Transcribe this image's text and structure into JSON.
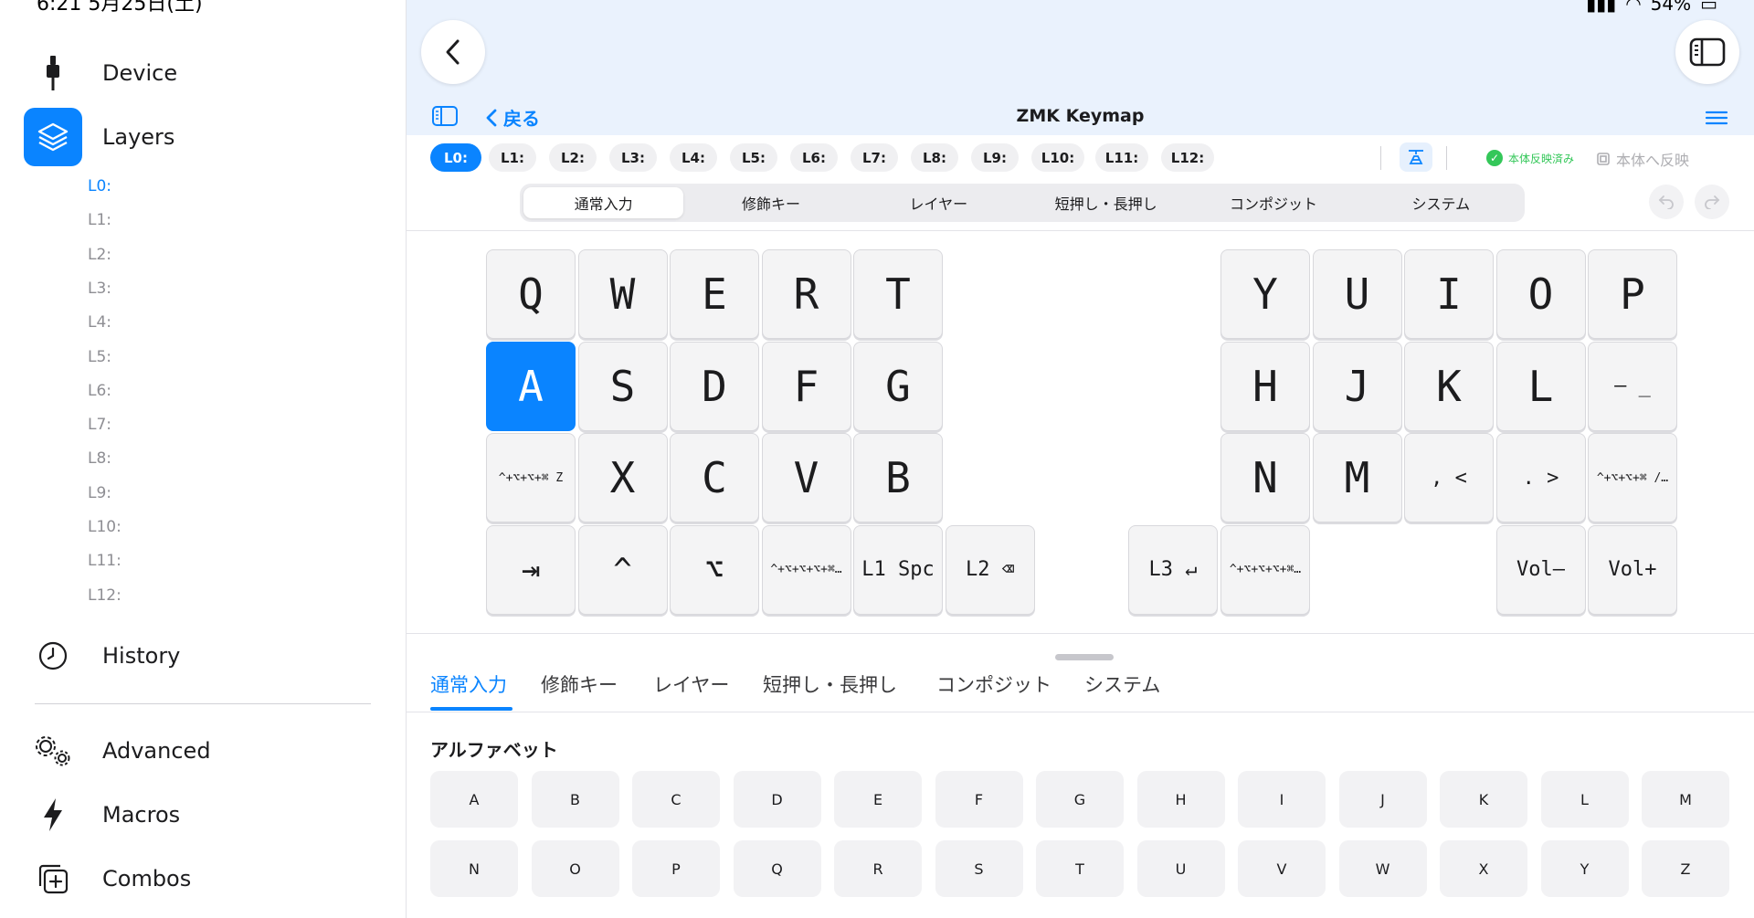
{
  "status": {
    "time": "6:21 5月25日(土)",
    "battery": "54%"
  },
  "sidebar": {
    "items": [
      {
        "label": "Device",
        "icon": "usb-plug-icon"
      },
      {
        "label": "Layers",
        "icon": "layers-icon"
      },
      {
        "label": "History",
        "icon": "clock-icon"
      },
      {
        "label": "Advanced",
        "icon": "gears-icon"
      },
      {
        "label": "Macros",
        "icon": "bolt-icon"
      },
      {
        "label": "Combos",
        "icon": "plus-square-icon"
      }
    ],
    "layers": [
      "L0:",
      "L1:",
      "L2:",
      "L3:",
      "L4:",
      "L5:",
      "L6:",
      "L7:",
      "L8:",
      "L9:",
      "L10:",
      "L11:",
      "L12:"
    ],
    "active_layer": "L0:"
  },
  "nav": {
    "back_label": "戻る",
    "title": "ZMK Keymap"
  },
  "layer_chips": [
    "L0:",
    "L1:",
    "L2:",
    "L3:",
    "L4:",
    "L5:",
    "L6:",
    "L7:",
    "L8:",
    "L9:",
    "L10:",
    "L11:",
    "L12:"
  ],
  "sync": {
    "saved": "本体反映済み",
    "apply": "本体へ反映"
  },
  "segments": [
    "通常入力",
    "修飾キー",
    "レイヤー",
    "短押し・長押し",
    "コンポジット",
    "システム"
  ],
  "keys": {
    "left": [
      [
        "Q",
        "W",
        "E",
        "R",
        "T"
      ],
      [
        "A",
        "S",
        "D",
        "F",
        "G"
      ],
      [
        "^+⌥+⌥+⌘ Z",
        "X",
        "C",
        "V",
        "B"
      ],
      [
        "⇥",
        "^",
        "⌥",
        "^+⌥+⌥+⌥+⌘…",
        "L1 Spc",
        "L2 ⌫"
      ]
    ],
    "right": [
      [
        "Y",
        "U",
        "I",
        "O",
        "P"
      ],
      [
        "H",
        "J",
        "K",
        "L",
        "– _"
      ],
      [
        "N",
        "M",
        ", <",
        ". >",
        "^+⌥+⌥+⌘ /…"
      ],
      [
        "L3 ↵",
        "^+⌥+⌥+⌥+⌘…",
        "Vol–",
        "Vol+"
      ]
    ],
    "selected": "A"
  },
  "panel": {
    "tabs": [
      "通常入力",
      "修飾キー",
      "レイヤー",
      "短押し・長押し",
      "コンポジット",
      "システム"
    ],
    "section": "アルファベット",
    "letters": [
      "A",
      "B",
      "C",
      "D",
      "E",
      "F",
      "G",
      "H",
      "I",
      "J",
      "K",
      "L",
      "M",
      "N",
      "O",
      "P",
      "Q",
      "R",
      "S",
      "T",
      "U",
      "V",
      "W",
      "X",
      "Y",
      "Z"
    ]
  },
  "colors": {
    "accent": "#0a84ff",
    "success": "#34c759",
    "topband": "#eaf2fd"
  }
}
